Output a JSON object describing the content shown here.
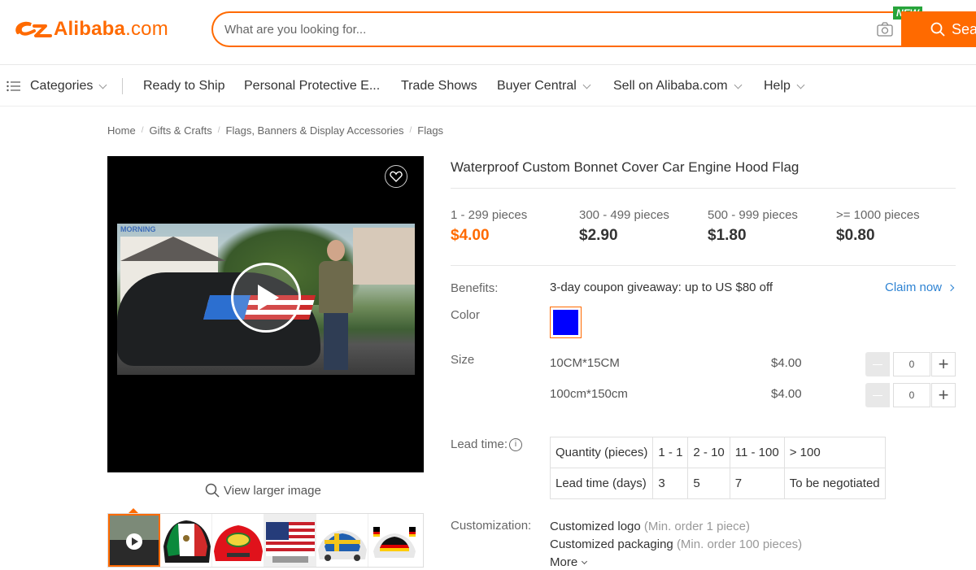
{
  "header": {
    "logo_text": "Alibaba",
    "logo_suffix": ".com",
    "search_placeholder": "What are you looking for...",
    "new_badge": "NEW",
    "search_button": "Sea",
    "brand_color": "#ff6a00"
  },
  "nav": {
    "categories": "Categories",
    "items": [
      "Ready to Ship",
      "Personal Protective E...",
      "Trade Shows",
      "Buyer Central",
      "Sell on Alibaba.com",
      "Help"
    ]
  },
  "breadcrumb": [
    "Home",
    "Gifts & Crafts",
    "Flags, Banners & Display Accessories",
    "Flags"
  ],
  "media": {
    "video_overlay_text": "MORNING",
    "view_larger": "View larger image",
    "thumbnails": [
      "video",
      "mexico-flag-car",
      "red-flag-car",
      "usa-flag-car",
      "sweden-flag-car",
      "germany-flag-car"
    ]
  },
  "product": {
    "title": "Waterproof Custom Bonnet Cover Car Engine Hood Flag",
    "tiers": [
      {
        "qty": "1 - 299 pieces",
        "price": "$4.00"
      },
      {
        "qty": "300 - 499 pieces",
        "price": "$2.90"
      },
      {
        "qty": "500 - 999 pieces",
        "price": "$1.80"
      },
      {
        "qty": ">= 1000 pieces",
        "price": "$0.80"
      }
    ],
    "benefits_label": "Benefits:",
    "benefits_text": "3-day coupon giveaway: up to US $80 off",
    "claim_now": "Claim now",
    "color_label": "Color",
    "color_swatch": "#0000ff",
    "size_label": "Size",
    "sizes": [
      {
        "name": "10CM*15CM",
        "price": "$4.00",
        "qty": "0"
      },
      {
        "name": "100cm*150cm",
        "price": "$4.00",
        "qty": "0"
      }
    ],
    "lead_time_label": "Lead time:",
    "lead_table": {
      "row1": [
        "Quantity (pieces)",
        "1 - 1",
        "2 - 10",
        "11 - 100",
        "> 100"
      ],
      "row2": [
        "Lead time (days)",
        "3",
        "5",
        "7",
        "To be negotiated"
      ]
    },
    "customization_label": "Customization:",
    "customizations": [
      {
        "name": "Customized logo",
        "note": "(Min. order 1 piece)"
      },
      {
        "name": "Customized packaging",
        "note": "(Min. order 100 pieces)"
      }
    ],
    "more": "More"
  }
}
